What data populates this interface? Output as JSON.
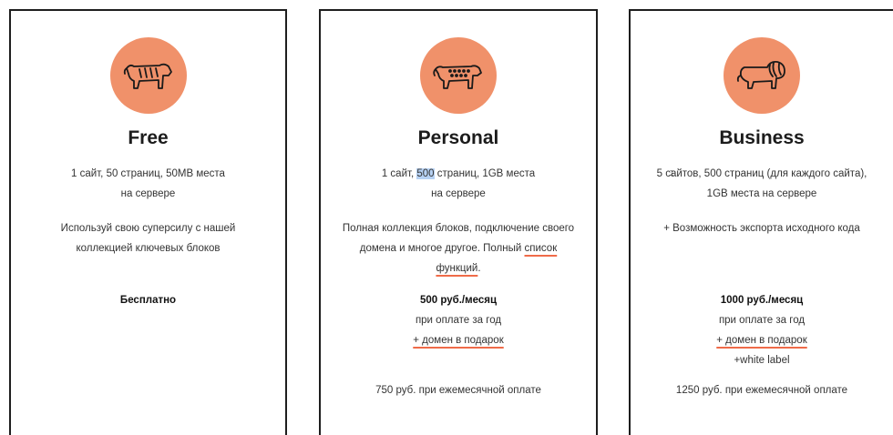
{
  "plans": [
    {
      "icon": "tiger-icon",
      "title": "Free",
      "desc_line1": "1 сайт, 50 страниц, 50MB места",
      "desc_line2": "на сервере",
      "feat_line1": "Используй свою суперсилу с нашей",
      "feat_line2": "коллекцией ключевых блоков",
      "price": "Бесплатно"
    },
    {
      "icon": "leopard-icon",
      "title": "Personal",
      "desc_pre": "1 сайт, ",
      "desc_highlight": "500",
      "desc_post": " страниц, 1GB места",
      "desc_line2": "на сервере",
      "feat_line1": "Полная коллекция блоков, подключение своего",
      "feat_line2_pre": "домена и многое другое. Полный ",
      "feat_link_part1": "список",
      "feat_link_part2": "функций",
      "feat_line3_post": ".",
      "price": "500 руб./месяц",
      "billing": "при оплате за год",
      "bonus": "+ домен в подарок",
      "monthly": "750 руб. при ежемесячной оплате"
    },
    {
      "icon": "lion-icon",
      "title": "Business",
      "desc_line1": "5 сайтов, 500 страниц (для каждого сайта),",
      "desc_line2": "1GB места на сервере",
      "feat_line1": "+ Возможность экспорта исходного кода",
      "price": "1000 руб./месяц",
      "billing": "при оплате за год",
      "bonus": "+ домен в подарок",
      "extra": "+white label",
      "monthly": "1250 руб. при ежемесячной оплате"
    }
  ],
  "colors": {
    "accent": "#f0916a",
    "underline": "#ef6b49",
    "highlight": "#b6d1f3",
    "border": "#1e1e1e"
  }
}
